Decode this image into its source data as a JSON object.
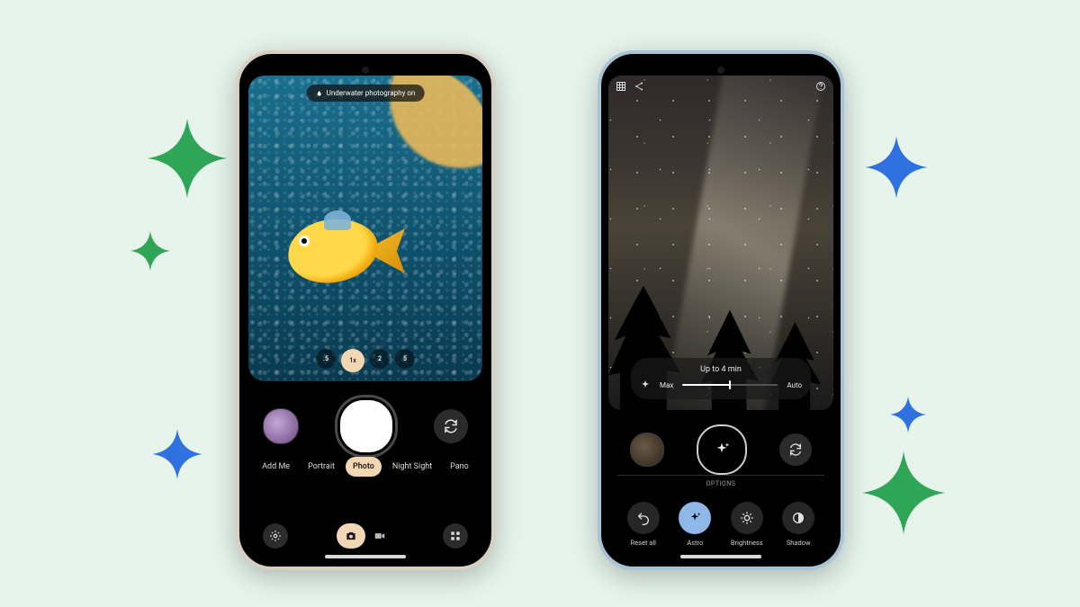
{
  "colors": {
    "green": "#2fa556",
    "blue": "#2f71e0",
    "camera_accent": "#f3d6b3",
    "editor_accent": "#8fb8e8"
  },
  "phone_a": {
    "toast": "Underwater photography on",
    "zoom_levels": [
      ".5",
      "1x",
      "2",
      "5"
    ],
    "zoom_selected_index": 1,
    "modes": [
      "Add Me",
      "Portrait",
      "Photo",
      "Night Sight",
      "Pano"
    ],
    "mode_selected_index": 2,
    "icons": {
      "gallery_thumb": "gallery-thumbnail",
      "shutter": "shutter",
      "flip": "camera-flip-icon",
      "settings": "settings-icon",
      "photo_mode": "photo-icon",
      "video_mode": "video-icon",
      "more": "more-icon"
    }
  },
  "phone_b": {
    "top_icons": {
      "grid": "grid-icon",
      "share": "share-icon",
      "help": "help-icon"
    },
    "exposure_panel": {
      "title": "Up to 4 min",
      "left_label": "Max",
      "right_label": "Auto"
    },
    "shutter_icon": "sparkle-icon",
    "options_label": "OPTIONS",
    "quick_actions": [
      {
        "label": "Reset all",
        "icon": "undo-icon",
        "selected": false
      },
      {
        "label": "Astro",
        "icon": "sparkle-icon",
        "selected": true
      },
      {
        "label": "Brightness",
        "icon": "brightness-icon",
        "selected": false
      },
      {
        "label": "Shadow",
        "icon": "shadow-icon",
        "selected": false
      }
    ]
  }
}
